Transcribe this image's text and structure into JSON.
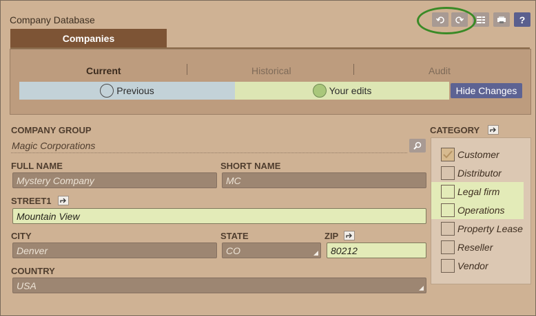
{
  "app": {
    "title": "Company Database"
  },
  "toolbar": {
    "undo_icon": "undo-icon",
    "redo_icon": "redo-icon",
    "list_icon": "list-icon",
    "print_icon": "printer-icon",
    "help_label": "?"
  },
  "tabs": {
    "main": "Companies"
  },
  "subtabs": [
    {
      "label": "Current",
      "active": true
    },
    {
      "label": "Historical",
      "active": false
    },
    {
      "label": "Audit",
      "active": false
    }
  ],
  "changes": {
    "previous_label": "Previous",
    "edits_label": "Your edits",
    "hide_button": "Hide Changes"
  },
  "form": {
    "company_group": {
      "label": "COMPANY GROUP",
      "value": "Magic Corporations"
    },
    "full_name": {
      "label": "FULL NAME",
      "value": "Mystery Company"
    },
    "short_name": {
      "label": "SHORT NAME",
      "value": "MC"
    },
    "street1": {
      "label": "STREET1",
      "value": "Mountain View"
    },
    "city": {
      "label": "CITY",
      "value": "Denver"
    },
    "state": {
      "label": "STATE",
      "value": "CO"
    },
    "zip": {
      "label": "ZIP",
      "value": "80212"
    },
    "country": {
      "label": "COUNTRY",
      "value": "USA"
    }
  },
  "category": {
    "label": "CATEGORY",
    "items": [
      {
        "label": "Customer",
        "checked": true,
        "edited": false
      },
      {
        "label": "Distributor",
        "checked": false,
        "edited": false
      },
      {
        "label": "Legal firm",
        "checked": false,
        "edited": true
      },
      {
        "label": "Operations",
        "checked": false,
        "edited": true
      },
      {
        "label": "Property Lease",
        "checked": false,
        "edited": false
      },
      {
        "label": "Reseller",
        "checked": false,
        "edited": false
      },
      {
        "label": "Vendor",
        "checked": false,
        "edited": false
      }
    ]
  },
  "colors": {
    "background": "#cfb294",
    "tab_active": "#7d5435",
    "edited_highlight": "#e3ebb8",
    "previous_highlight": "#c3d2d8",
    "button_primary": "#5d6393",
    "annotation_ring": "#3a8a26"
  }
}
